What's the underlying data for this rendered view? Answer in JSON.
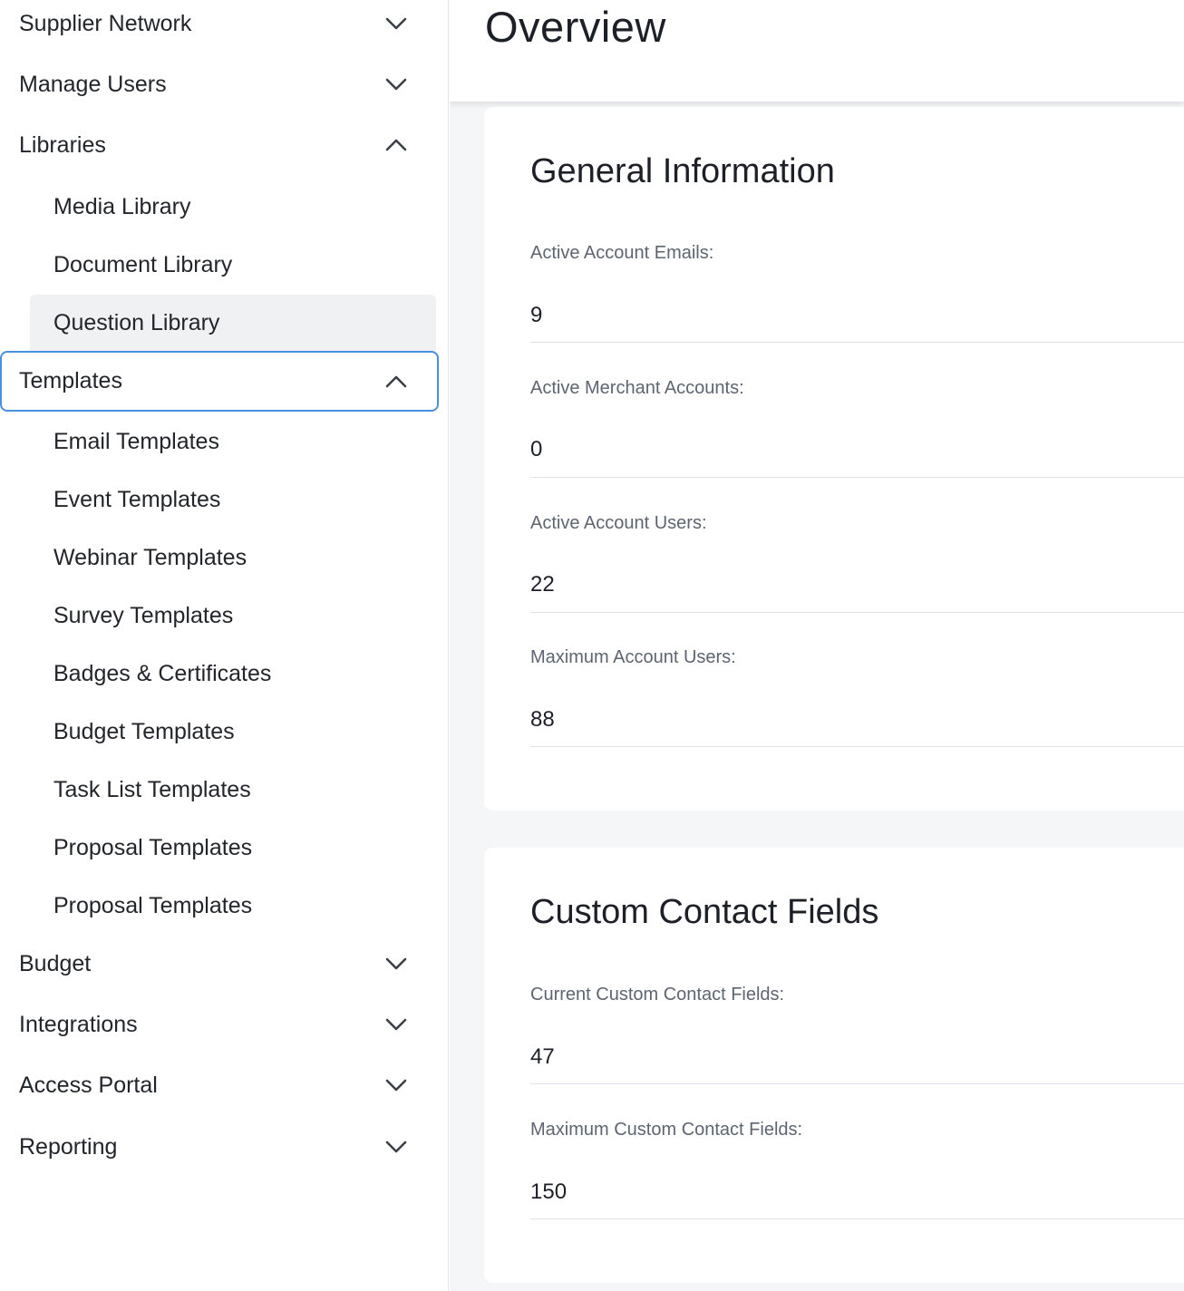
{
  "sidebar": {
    "items": [
      {
        "label": "Supplier Network",
        "expanded": false
      },
      {
        "label": "Manage Users",
        "expanded": false
      },
      {
        "label": "Libraries",
        "expanded": true
      },
      {
        "label": "Templates",
        "expanded": true
      },
      {
        "label": "Budget",
        "expanded": false
      },
      {
        "label": "Integrations",
        "expanded": false
      },
      {
        "label": "Access Portal",
        "expanded": false
      },
      {
        "label": "Reporting",
        "expanded": false
      }
    ],
    "libraries_sub": [
      {
        "label": "Media Library"
      },
      {
        "label": "Document Library"
      },
      {
        "label": "Question Library"
      }
    ],
    "templates_sub": [
      {
        "label": "Email Templates"
      },
      {
        "label": "Event Templates"
      },
      {
        "label": "Webinar Templates"
      },
      {
        "label": "Survey Templates"
      },
      {
        "label": "Badges & Certificates"
      },
      {
        "label": "Budget Templates"
      },
      {
        "label": "Task List Templates"
      },
      {
        "label": "Proposal Templates"
      },
      {
        "label": "Proposal Templates"
      }
    ]
  },
  "main": {
    "title": "Overview",
    "general": {
      "title": "General Information",
      "fields": [
        {
          "label": "Active Account Emails:",
          "value": "9"
        },
        {
          "label": "Active Merchant Accounts:",
          "value": "0"
        },
        {
          "label": "Active Account Users:",
          "value": "22"
        },
        {
          "label": "Maximum Account Users:",
          "value": "88"
        }
      ]
    },
    "custom": {
      "title": "Custom Contact Fields",
      "fields": [
        {
          "label": "Current Custom Contact Fields:",
          "value": "47"
        },
        {
          "label": "Maximum Custom Contact Fields:",
          "value": "150"
        }
      ]
    }
  },
  "colors": {
    "focus_border": "#4a90e2",
    "active_item_bg": "#f0f1f3",
    "main_bg": "#f5f6f8"
  },
  "icons": {
    "collapsed": "chevron-down-icon",
    "expanded": "chevron-up-icon"
  }
}
